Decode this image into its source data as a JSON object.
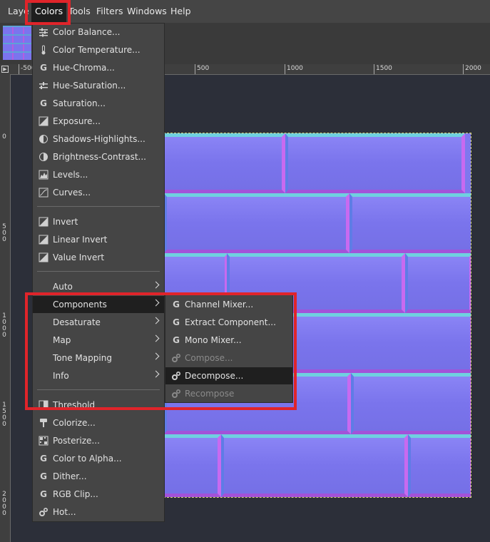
{
  "menubar": {
    "items": [
      "Laye",
      "Colors",
      "Tools",
      "Filters",
      "Windows",
      "Help"
    ],
    "active": "Colors"
  },
  "ruler": {
    "h_labels": [
      "-500",
      "500",
      "1000",
      "1500",
      "2000"
    ],
    "v_labels": [
      "0",
      "500",
      "1000",
      "1500",
      "2000"
    ]
  },
  "colors_menu": {
    "items": [
      {
        "label": "Color Balance...",
        "icon": "color-balance-icon"
      },
      {
        "label": "Color Temperature...",
        "icon": "thermometer-icon"
      },
      {
        "label": "Hue-Chroma...",
        "icon": "gegl-icon"
      },
      {
        "label": "Hue-Saturation...",
        "icon": "hue-saturation-icon"
      },
      {
        "label": "Saturation...",
        "icon": "gegl-icon"
      },
      {
        "label": "Exposure...",
        "icon": "exposure-icon"
      },
      {
        "label": "Shadows-Highlights...",
        "icon": "shadows-highlights-icon"
      },
      {
        "label": "Brightness-Contrast...",
        "icon": "brightness-contrast-icon"
      },
      {
        "label": "Levels...",
        "icon": "levels-icon"
      },
      {
        "label": "Curves...",
        "icon": "curves-icon"
      },
      {
        "label": "Invert",
        "icon": "invert-icon"
      },
      {
        "label": "Linear Invert",
        "icon": "invert-icon"
      },
      {
        "label": "Value Invert",
        "icon": "invert-icon"
      },
      {
        "label": "Auto",
        "icon": ""
      },
      {
        "label": "Components",
        "icon": ""
      },
      {
        "label": "Desaturate",
        "icon": ""
      },
      {
        "label": "Map",
        "icon": ""
      },
      {
        "label": "Tone Mapping",
        "icon": ""
      },
      {
        "label": "Info",
        "icon": ""
      },
      {
        "label": "Threshold",
        "icon": "threshold-icon"
      },
      {
        "label": "Colorize...",
        "icon": "colorize-icon"
      },
      {
        "label": "Posterize...",
        "icon": "posterize-icon"
      },
      {
        "label": "Color to Alpha...",
        "icon": "gegl-icon"
      },
      {
        "label": "Dither...",
        "icon": "gegl-icon"
      },
      {
        "label": "RGB Clip...",
        "icon": "gegl-icon"
      },
      {
        "label": "Hot...",
        "icon": "plugin-gear-icon"
      }
    ]
  },
  "components_submenu": {
    "items": [
      {
        "label": "Channel Mixer...",
        "icon": "gegl-icon",
        "enabled": true
      },
      {
        "label": "Extract Component...",
        "icon": "gegl-icon",
        "enabled": true
      },
      {
        "label": "Mono Mixer...",
        "icon": "gegl-icon",
        "enabled": true
      },
      {
        "label": "Compose...",
        "icon": "plugin-gear-icon",
        "enabled": false
      },
      {
        "label": "Decompose...",
        "icon": "plugin-gear-icon",
        "enabled": true
      },
      {
        "label": "Recompose",
        "icon": "plugin-gear-icon",
        "enabled": false
      }
    ]
  },
  "colors": {
    "highlight_red": "#e0242a",
    "menu_bg": "#454545",
    "image_base": "#7e78ee"
  }
}
